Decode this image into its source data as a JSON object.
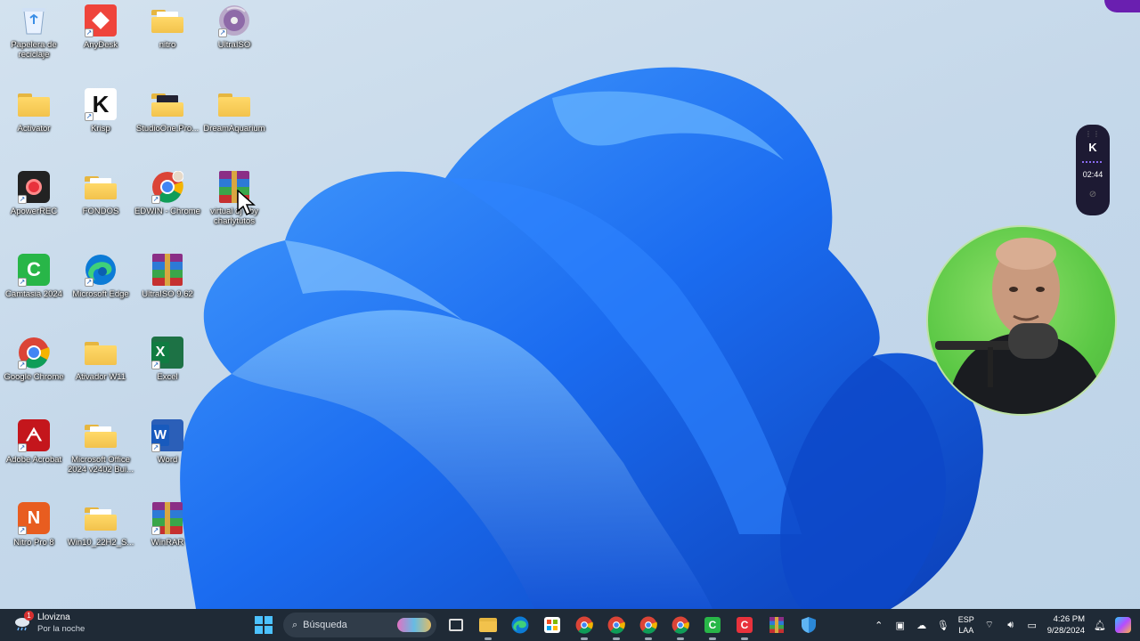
{
  "desktop": {
    "icons": [
      {
        "label": "Papelera de reciclaje",
        "icon": "recycle-bin-icon"
      },
      {
        "label": "AnyDesk",
        "icon": "anydesk-icon"
      },
      {
        "label": "nitro",
        "icon": "folder-icon"
      },
      {
        "label": "UltraISO",
        "icon": "disc-icon"
      },
      {
        "label": "Activator",
        "icon": "folder-icon"
      },
      {
        "label": "Krisp",
        "icon": "krisp-icon"
      },
      {
        "label": "StudioOne.Pro...",
        "icon": "folder-icon"
      },
      {
        "label": "DreamAquarium",
        "icon": "folder-icon"
      },
      {
        "label": "ApowerREC",
        "icon": "apowerrec-icon"
      },
      {
        "label": "FONDOS",
        "icon": "folder-icon"
      },
      {
        "label": "EDWIN - Chrome",
        "icon": "chrome-icon"
      },
      {
        "label": "virtual dj - by charlytutos",
        "icon": "winrar-icon"
      },
      {
        "label": "Camtasia 2024",
        "icon": "camtasia-icon"
      },
      {
        "label": "Microsoft Edge",
        "icon": "edge-icon"
      },
      {
        "label": "UltraISO 9.62",
        "icon": "winrar-icon"
      },
      {
        "label": "Google Chrome",
        "icon": "chrome-icon"
      },
      {
        "label": "Ativador W11",
        "icon": "folder-icon"
      },
      {
        "label": "Excel",
        "icon": "excel-icon"
      },
      {
        "label": "Adobe Acrobat",
        "icon": "acrobat-icon"
      },
      {
        "label": "Microsoft Office 2024 v2402 Bui...",
        "icon": "folder-icon"
      },
      {
        "label": "Word",
        "icon": "word-icon"
      },
      {
        "label": "Nitro Pro 8",
        "icon": "nitro-icon"
      },
      {
        "label": "Win10_22H2_S...",
        "icon": "folder-icon"
      },
      {
        "label": "WinRAR",
        "icon": "winrar-icon"
      }
    ]
  },
  "recorder": {
    "logo": "K",
    "time": "02:44"
  },
  "taskbar": {
    "weather": {
      "badge": "1",
      "condition": "Llovizna",
      "subtitle": "Por la noche"
    },
    "search_placeholder": "Búsqueda",
    "pinned": [
      "start-icon",
      "task-view-icon",
      "file-explorer-icon",
      "edge-icon",
      "store-icon",
      "chrome-icon",
      "chrome-icon",
      "chrome-icon",
      "chrome-icon",
      "camtasia-icon",
      "apowerrec-icon",
      "winrar-icon",
      "defender-icon"
    ],
    "tray": {
      "lang_top": "ESP",
      "lang_bottom": "LAA",
      "time": "4:26 PM",
      "date": "9/28/2024"
    }
  },
  "colors": {
    "taskbar_bg": "#1f2a36",
    "bloom_blue": "#1a64e0",
    "webcam_green": "#5bc845",
    "recorder_bg": "#1d1a33"
  }
}
